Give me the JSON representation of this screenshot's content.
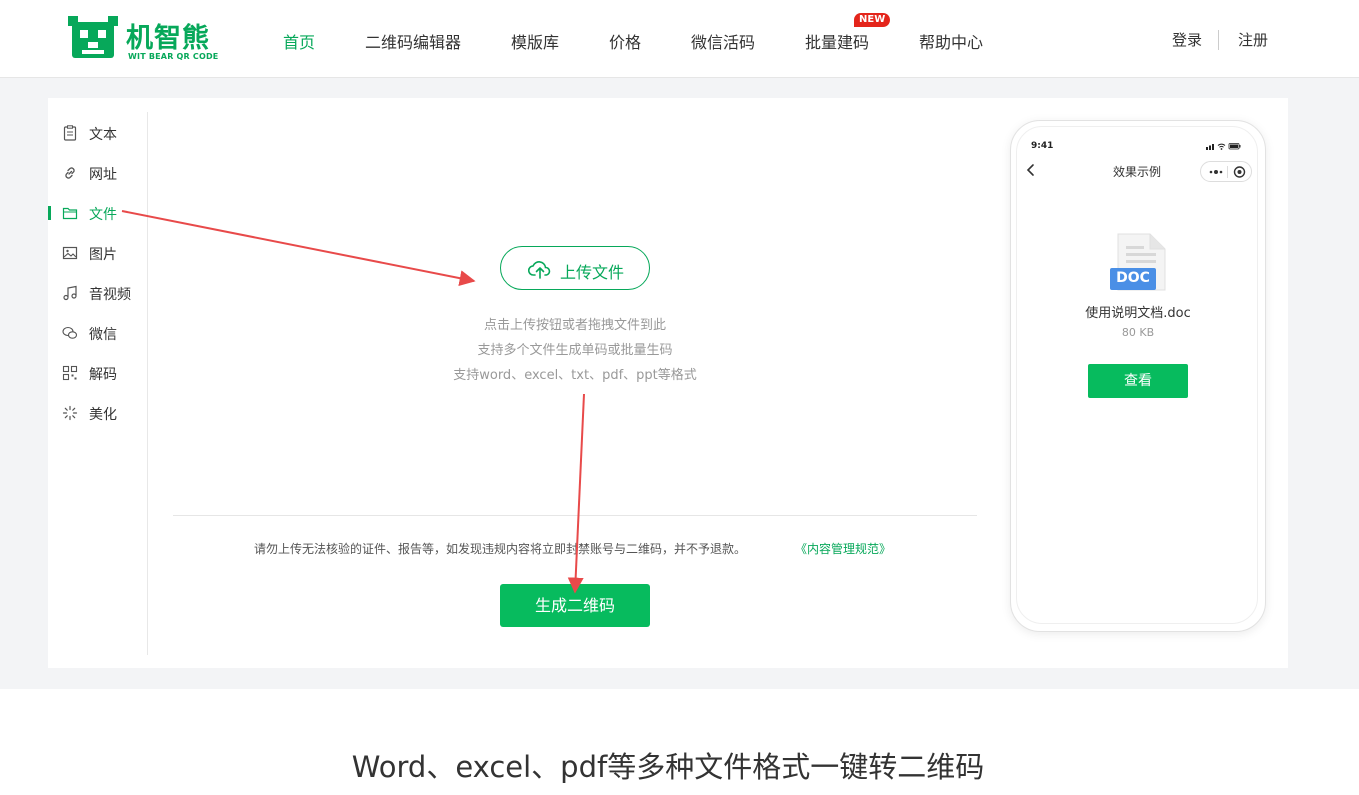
{
  "brand": {
    "name": "机智熊",
    "tagline": "WIT BEAR QR CODE",
    "accent_color": "#07a85a",
    "button_color": "#07bb5e"
  },
  "nav": {
    "items": [
      "首页",
      "二维码编辑器",
      "模版库",
      "价格",
      "微信活码",
      "批量建码",
      "帮助中心"
    ],
    "active": "首页",
    "new_badge": "NEW"
  },
  "auth": {
    "login": "登录",
    "register": "注册"
  },
  "sidebar": {
    "items": [
      {
        "label": "文本",
        "icon": "clipboard-icon"
      },
      {
        "label": "网址",
        "icon": "link-icon"
      },
      {
        "label": "文件",
        "icon": "folder-icon"
      },
      {
        "label": "图片",
        "icon": "image-icon"
      },
      {
        "label": "音视频",
        "icon": "music-icon"
      },
      {
        "label": "微信",
        "icon": "wechat-icon"
      },
      {
        "label": "解码",
        "icon": "qr-scan-icon"
      },
      {
        "label": "美化",
        "icon": "sparkle-icon"
      }
    ],
    "active": "文件"
  },
  "upload": {
    "button_label": "上传文件",
    "hints": [
      "点击上传按钮或者拖拽文件到此",
      "支持多个文件生成单码或批量生码",
      "支持word、excel、txt、pdf、ppt等格式"
    ]
  },
  "notice": {
    "text": "请勿上传无法核验的证件、报告等，如发现违规内容将立即封禁账号与二维码，并不予退款。",
    "link": "《内容管理规范》"
  },
  "generate_button": "生成二维码",
  "preview": {
    "time": "9:41",
    "title": "效果示例",
    "doc_badge": "DOC",
    "file_name": "使用说明文档.doc",
    "file_size": "80 KB",
    "view_button": "查看"
  },
  "bottom_title": "Word、excel、pdf等多种文件格式一键转二维码"
}
